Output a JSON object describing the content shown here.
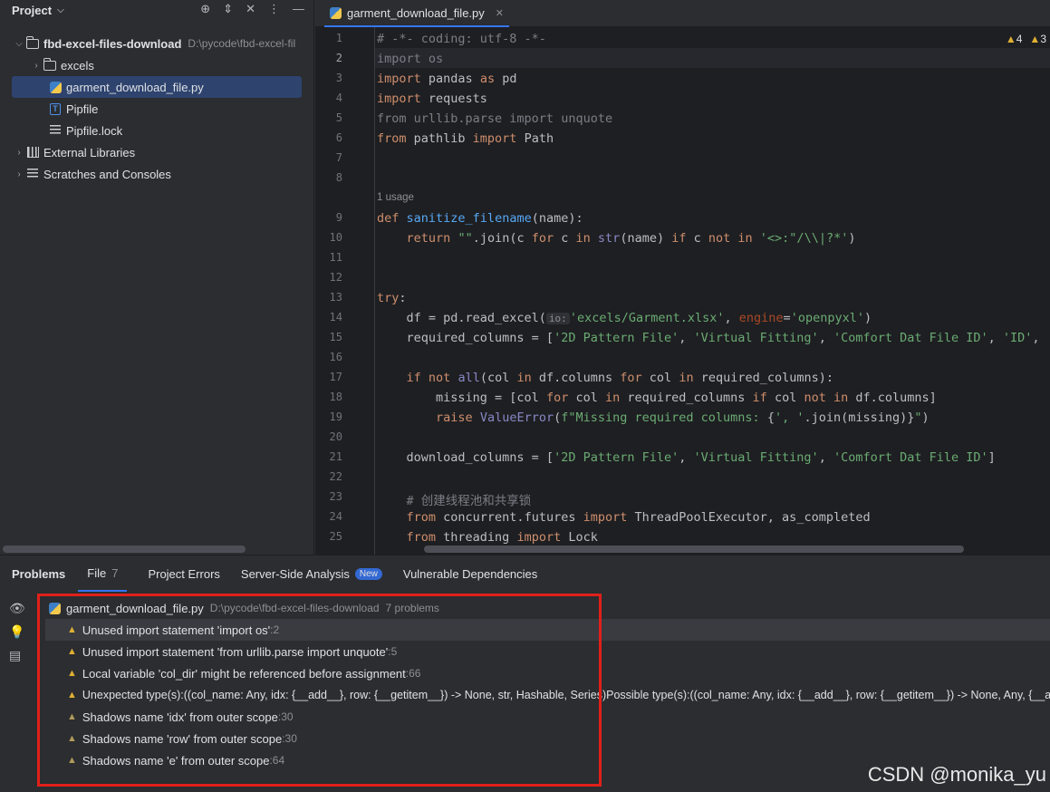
{
  "project": {
    "title": "Project",
    "root_name": "fbd-excel-files-download",
    "root_path": "D:\\pycode\\fbd-excel-fil",
    "items": [
      {
        "label": "excels"
      },
      {
        "label": "garment_download_file.py"
      },
      {
        "label": "Pipfile"
      },
      {
        "label": "Pipfile.lock"
      }
    ],
    "ext_libs": "External Libraries",
    "scratches": "Scratches and Consoles"
  },
  "editor": {
    "tab_label": "garment_download_file.py",
    "warnings": "4",
    "weak": "3",
    "usage_hint": "1 usage",
    "param_hint": "io:",
    "line_numbers": [
      "1",
      "2",
      "3",
      "4",
      "5",
      "6",
      "7",
      "8",
      "9",
      "10",
      "11",
      "12",
      "13",
      "14",
      "15",
      "16",
      "17",
      "18",
      "19",
      "20",
      "21",
      "22",
      "23",
      "24",
      "25"
    ]
  },
  "problems": {
    "tabs": {
      "problems": "Problems",
      "file": "File",
      "file_count": "7",
      "project_errors": "Project Errors",
      "server_side": "Server-Side Analysis",
      "new_badge": "New",
      "vulnerable": "Vulnerable Dependencies"
    },
    "file_name": "garment_download_file.py",
    "file_path": "D:\\pycode\\fbd-excel-files-download",
    "file_summary": "7 problems",
    "items": [
      {
        "text": "Unused import statement 'import os'",
        "line": ":2"
      },
      {
        "text": "Unused import statement 'from urllib.parse import unquote'",
        "line": ":5"
      },
      {
        "text": "Local variable 'col_dir' might be referenced before assignment",
        "line": ":66"
      },
      {
        "text": "Unexpected type(s):((col_name: Any, idx: {__add__}, row: {__getitem__}) -> None, str, Hashable, Series)Possible type(s):((col_name: Any, idx: {__add__}, row: {__getitem__}) -> None, Any, {__a",
        "line": ""
      },
      {
        "text": "Shadows name 'idx' from outer scope",
        "line": ":30"
      },
      {
        "text": "Shadows name 'row' from outer scope",
        "line": ":30"
      },
      {
        "text": "Shadows name 'e' from outer scope",
        "line": ":64"
      }
    ]
  },
  "watermark": "CSDN @monika_yu"
}
